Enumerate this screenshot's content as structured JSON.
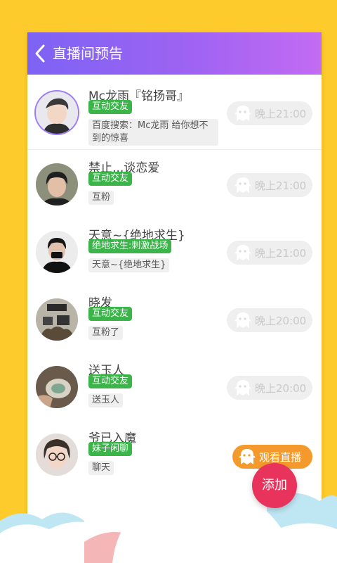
{
  "header": {
    "title": "直播间预告"
  },
  "rows": [
    {
      "name": "Mc龙雨『铭扬哥』",
      "tag": "互动交友",
      "desc": "百度搜索：Mc龙雨  给你想不到的惊喜",
      "button": "晚上21:00"
    },
    {
      "name": "禁止,,,谈恋爱",
      "tag": "互动交友",
      "desc": "互粉",
      "button": "晚上21:00"
    },
    {
      "name": "天意~{绝地求生}",
      "tag": "绝地求生:刺激战场",
      "desc": "天意~{绝地求生}",
      "button": "晚上21:00"
    },
    {
      "name": "晓发",
      "tag": "互动交友",
      "desc": "互粉了",
      "button": "晚上20:00"
    },
    {
      "name": "送玉人",
      "tag": "互动交友",
      "desc": "送玉人",
      "button": "晚上20:00"
    },
    {
      "name": "爷已入魔",
      "tag": "妹子闲聊",
      "desc": "聊天",
      "button": "观看直播"
    }
  ],
  "fab": {
    "label": "添加"
  },
  "colors": {
    "background": "#FDCB2B",
    "header_gradient_start": "#7D63F5",
    "header_gradient_end": "#C36BF3",
    "tag_green": "#3BB549",
    "watch_orange": "#F49A2C",
    "fab_pink": "#E8345D"
  },
  "icons": {
    "back": "chevron-left-icon",
    "button": "ghost-mascot-icon"
  }
}
